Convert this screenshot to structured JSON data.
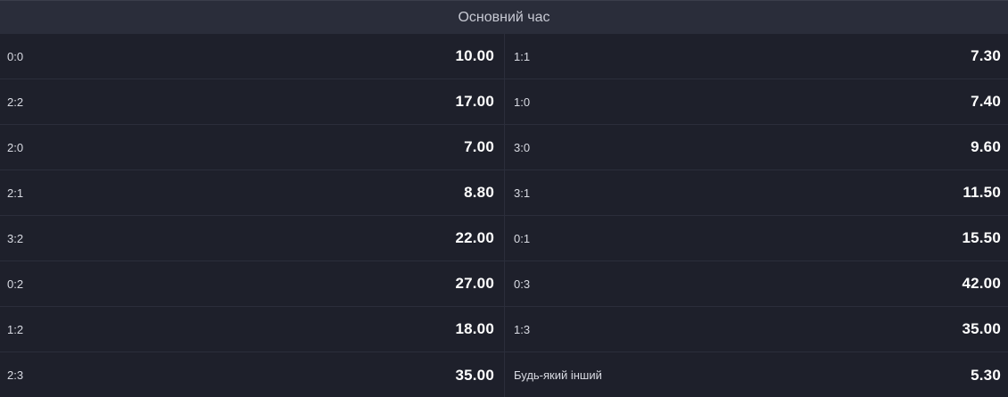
{
  "market": {
    "title": "Основний час",
    "rows": [
      {
        "left": {
          "score": "0:0",
          "odds": "10.00"
        },
        "right": {
          "score": "1:1",
          "odds": "7.30"
        }
      },
      {
        "left": {
          "score": "2:2",
          "odds": "17.00"
        },
        "right": {
          "score": "1:0",
          "odds": "7.40"
        }
      },
      {
        "left": {
          "score": "2:0",
          "odds": "7.00"
        },
        "right": {
          "score": "3:0",
          "odds": "9.60"
        }
      },
      {
        "left": {
          "score": "2:1",
          "odds": "8.80"
        },
        "right": {
          "score": "3:1",
          "odds": "11.50"
        }
      },
      {
        "left": {
          "score": "3:2",
          "odds": "22.00"
        },
        "right": {
          "score": "0:1",
          "odds": "15.50"
        }
      },
      {
        "left": {
          "score": "0:2",
          "odds": "27.00"
        },
        "right": {
          "score": "0:3",
          "odds": "42.00"
        }
      },
      {
        "left": {
          "score": "1:2",
          "odds": "18.00"
        },
        "right": {
          "score": "1:3",
          "odds": "35.00"
        }
      },
      {
        "left": {
          "score": "2:3",
          "odds": "35.00"
        },
        "right": {
          "score": "Будь-який інший",
          "odds": "5.30"
        }
      }
    ]
  }
}
